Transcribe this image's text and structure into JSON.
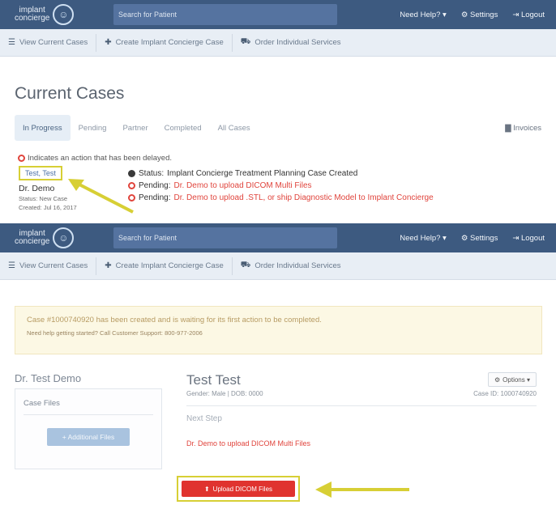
{
  "top": {
    "nav": {
      "brand_line1": "implant",
      "brand_line2": "concierge",
      "search_placeholder": "Search for Patient",
      "help": "Need Help? ▾",
      "settings": "Settings",
      "logout": "Logout"
    },
    "subnav": [
      "View Current Cases",
      "Create Implant Concierge Case",
      "Order Individual Services"
    ],
    "page_title": "Current Cases",
    "tabs": [
      "In Progress",
      "Pending",
      "Partner",
      "Completed",
      "All Cases"
    ],
    "invoices": "Invoices",
    "delayed_note": "Indicates an action that has been delayed.",
    "case": {
      "link": "Test, Test",
      "doctor": "Dr. Demo",
      "status_small": "Status: New Case",
      "created_small": "Created: Jul 16, 2017"
    },
    "status_lines": [
      {
        "label": "Status:",
        "text": "Implant Concierge Treatment Planning Case Created",
        "icon": "check-circle-icon"
      },
      {
        "label": "Pending:",
        "text": "Dr. Demo to upload DICOM Multi Files",
        "icon": "alert-circle-icon"
      },
      {
        "label": "Pending:",
        "text": "Dr. Demo to upload .STL, or ship Diagnostic Model to Implant Concierge",
        "icon": "alert-circle-icon"
      }
    ]
  },
  "bottom": {
    "nav": {
      "brand_line1": "implant",
      "brand_line2": "concierge",
      "search_placeholder": "Search for Patient",
      "help": "Need Help? ▾",
      "settings": "Settings",
      "logout": "Logout"
    },
    "subnav": [
      "View Current Cases",
      "Create Implant Concierge Case",
      "Order Individual Services"
    ],
    "alert_main": "Case #1000740920 has been created and is waiting for its first action to be completed.",
    "alert_sub": "Need help getting started? Call Customer Support: 800-977-2006",
    "left_name": "Dr. Test Demo",
    "case_files": "Case Files",
    "add_files": "+ Additional Files",
    "patient_name": "Test Test",
    "options": "Options ▾",
    "gender_dob": "Gender: Male | DOB: 0000",
    "case_id": "Case ID: 1000740920",
    "next_step": "Next Step",
    "next_action": "Dr. Demo to upload DICOM Multi Files",
    "upload_btn": "Upload DICOM Files"
  },
  "colors": {
    "navbar": "#3d5a80",
    "highlight": "#d7cf35",
    "alert_red": "#e0443c",
    "upload_red": "#e0332f"
  }
}
